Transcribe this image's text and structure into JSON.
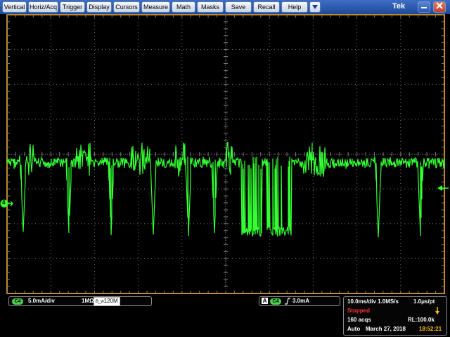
{
  "menu": {
    "items": [
      "Vertical",
      "Horiz/Acq",
      "Trigger",
      "Display",
      "Cursors",
      "Measure",
      "Math",
      "Masks",
      "Save",
      "Recall",
      "Help"
    ],
    "dropdown_icon": "triangle-down-icon",
    "brand": "Tek",
    "minimize_icon": "minimize-icon",
    "close_icon": "close-icon"
  },
  "display": {
    "trace_color": "#33ff33",
    "grid_color": "#7a7a7a",
    "border_color": "#c08a2a",
    "channel_marker": "4",
    "trigger_level_icon": "trigger-level-arrow-icon"
  },
  "channel": {
    "badge": "C4",
    "scale": "5.0mA/div",
    "impedance": "1MΩ",
    "bandwidth": "120M",
    "bandwidth_prefix": "B_w"
  },
  "trigger": {
    "mode_badge": "A",
    "source_badge": "C4",
    "slope_icon": "rising-edge-icon",
    "level": "3.0mA"
  },
  "acquisition": {
    "timebase": "10.0ms/div 1.0MS/s",
    "resolution": "1.0μs/pt",
    "state": "Stopped",
    "acqs": "160 acqs",
    "record_length": "RL:100.0k",
    "mode": "Auto",
    "date": "March 27, 2018",
    "time": "18:52:21",
    "state_color": "#ff3333",
    "time_color": "#ffc000"
  }
}
